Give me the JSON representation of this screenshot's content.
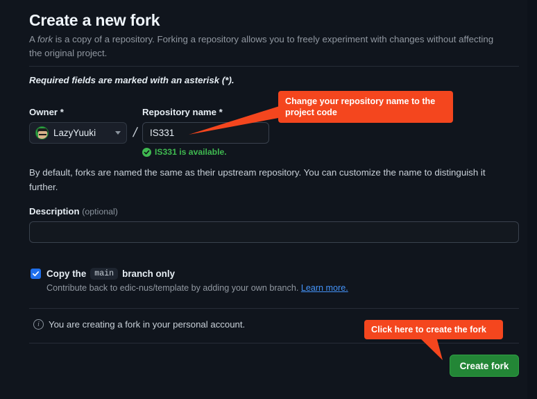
{
  "page": {
    "title": "Create a new fork",
    "description_part1": "A ",
    "description_em": "fork",
    "description_part2": " is a copy of a repository. Forking a repository allows you to freely experiment with changes without affecting the original project.",
    "required_note": "Required fields are marked with an asterisk (*)."
  },
  "owner": {
    "label": "Owner *",
    "value": "LazyYuuki",
    "avatar_icon": "user-avatar"
  },
  "separator": "/",
  "repository": {
    "label": "Repository name *",
    "value": "IS331",
    "placeholder": "",
    "availability_message": "IS331 is available.",
    "availability_icon": "check-circle-icon",
    "availability_color": "#3fb950"
  },
  "helper": {
    "text": "By default, forks are named the same as their upstream repository. You can customize the name to distinguish it further."
  },
  "description_field": {
    "label": "Description",
    "optional_tag": "(optional)",
    "value": "",
    "placeholder": ""
  },
  "branch_option": {
    "checked": true,
    "label_prefix": "Copy the",
    "branch_name": "main",
    "label_suffix": "branch only",
    "sub_text": "Contribute back to edic-nus/template by adding your own branch.",
    "link_text": "Learn more.",
    "link_color": "#4493f8"
  },
  "footer": {
    "info_icon": "info-icon",
    "personal_account_note": "You are creating a fork in your personal account.",
    "create_button_label": "Create fork",
    "create_button_color": "#238636"
  },
  "annotations": {
    "accent_color": "#f4461e",
    "repo_callout": "Change your repository name to the project code",
    "button_callout": "Click here to create the fork"
  }
}
